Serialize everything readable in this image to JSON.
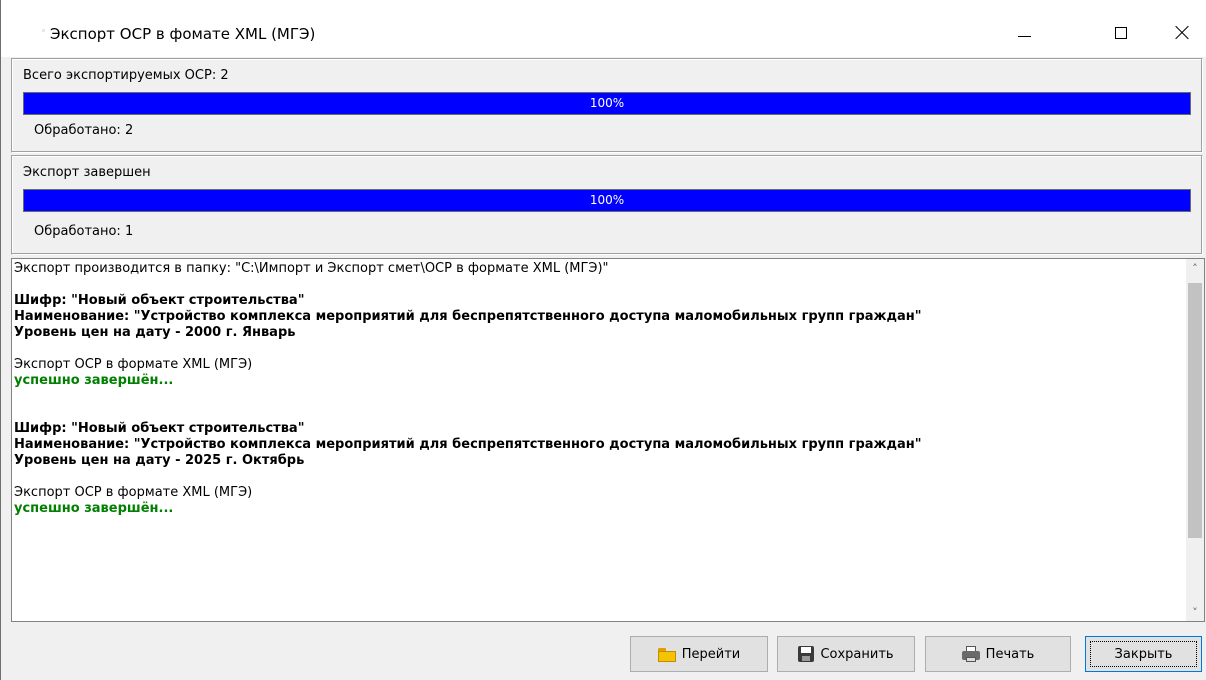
{
  "window": {
    "title": "Экспорт ОСР в фомате XML (МГЭ)"
  },
  "total_group": {
    "label": "Всего экспортируемых ОСР: 2",
    "progress": {
      "percent": 100,
      "text": "100%"
    },
    "processed": "Обработано:  2"
  },
  "current_group": {
    "label": "Экспорт завершен",
    "progress": {
      "percent": 100,
      "text": "100%"
    },
    "processed": "Обработано:  1"
  },
  "log": {
    "lines": [
      {
        "text": "Экспорт производится в папку: \"C:\\Импорт и Экспорт смет\\ОСР в формате XML (МГЭ)\"",
        "style": "normal"
      },
      {
        "text": "",
        "style": "blank"
      },
      {
        "text": "Шифр: \"Новый объект строительства\"",
        "style": "bold"
      },
      {
        "text": "Наименование: \"Устройство комплекса мероприятий для беспрепятственного доступа маломобильных групп граждан\"",
        "style": "bold"
      },
      {
        "text": "Уровень цен на дату - 2000 г. Январь",
        "style": "bold"
      },
      {
        "text": "",
        "style": "blank"
      },
      {
        "text": "Экспорт ОСР в формате XML (МГЭ)",
        "style": "normal"
      },
      {
        "text": "успешно завершён...",
        "style": "success"
      },
      {
        "text": "",
        "style": "blank"
      },
      {
        "text": "",
        "style": "blank"
      },
      {
        "text": "Шифр: \"Новый объект строительства\"",
        "style": "bold"
      },
      {
        "text": "Наименование: \"Устройство комплекса мероприятий для беспрепятственного доступа маломобильных групп граждан\"",
        "style": "bold"
      },
      {
        "text": "Уровень цен на дату - 2025 г. Октябрь",
        "style": "bold"
      },
      {
        "text": "",
        "style": "blank"
      },
      {
        "text": "Экспорт ОСР в формате XML (МГЭ)",
        "style": "normal"
      },
      {
        "text": "успешно завершён...",
        "style": "success"
      }
    ]
  },
  "buttons": {
    "goto": "Перейти",
    "save": "Сохранить",
    "print": "Печать",
    "close": "Закрыть"
  },
  "icons": {
    "goto": "folder-icon",
    "save": "floppy-disk-icon",
    "print": "printer-icon"
  },
  "colors": {
    "progress_fill": "#0000ff",
    "success_text": "#008000"
  }
}
